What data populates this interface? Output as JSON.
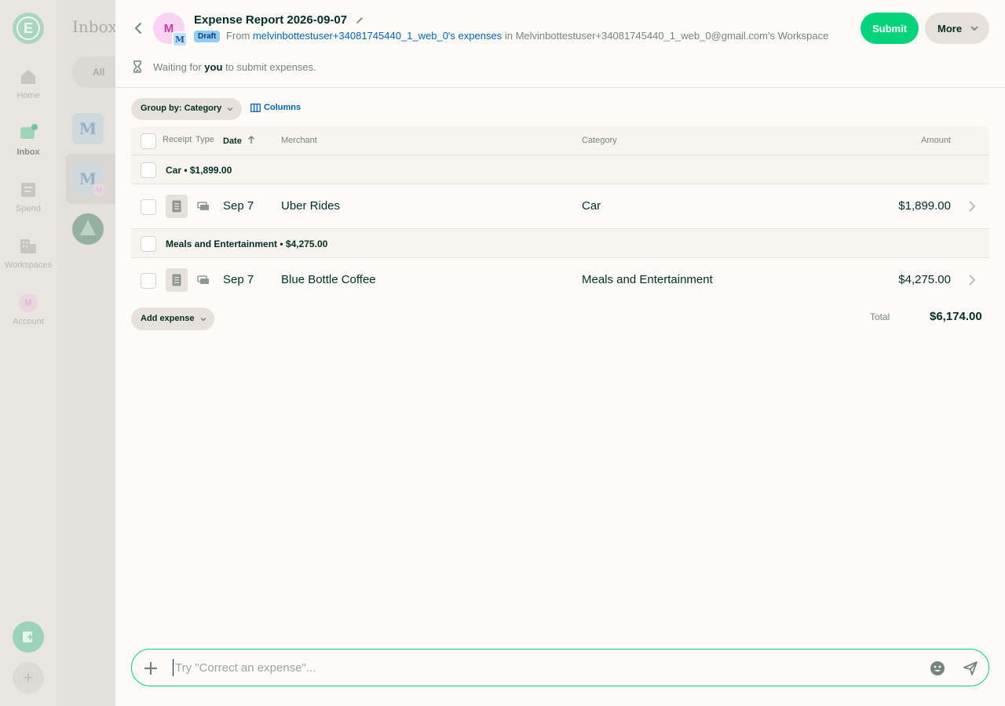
{
  "nav": {
    "items": [
      {
        "label": "Home",
        "icon": "home-icon"
      },
      {
        "label": "Inbox",
        "icon": "inbox-icon"
      },
      {
        "label": "Spend",
        "icon": "receipt-icon"
      },
      {
        "label": "Workspaces",
        "icon": "building-icon"
      },
      {
        "label": "Account",
        "icon": "avatar"
      }
    ],
    "account_initial": "M",
    "logo_letter": "E"
  },
  "inbox": {
    "title": "Inbox",
    "filter_label": "All",
    "avatar_letter": "M",
    "mini_avatar_letter": "M"
  },
  "report": {
    "title": "Expense Report 2026-09-07",
    "avatar_initial": "M",
    "workspace_initial": "M",
    "status_badge": "Draft",
    "from_label": "From",
    "from_link": "melvinbottestuser+34081745440_1_web_0's expenses",
    "in_label": "in",
    "workspace_name": "Melvinbottestuser+34081745440_1_web_0@gmail.com's Workspace",
    "submit_label": "Submit",
    "more_label": "More",
    "waiting_prefix": "Waiting for",
    "waiting_bold": "you",
    "waiting_suffix": "to submit expenses."
  },
  "toolbar": {
    "group_by_label": "Group by: Category",
    "columns_label": "Columns"
  },
  "table": {
    "columns": {
      "receipt": "Receipt",
      "type": "Type",
      "date": "Date",
      "merchant": "Merchant",
      "category": "Category",
      "amount": "Amount"
    },
    "groups": [
      {
        "heading": "Car • $1,899.00",
        "items": [
          {
            "date": "Sep 7",
            "merchant": "Uber Rides",
            "category": "Car",
            "amount": "$1,899.00"
          }
        ]
      },
      {
        "heading": "Meals and Entertainment • $4,275.00",
        "items": [
          {
            "date": "Sep 7",
            "merchant": "Blue Bottle Coffee",
            "category": "Meals and Entertainment",
            "amount": "$4,275.00"
          }
        ]
      }
    ]
  },
  "footer": {
    "add_expense_label": "Add expense",
    "total_label": "Total",
    "total_value": "$6,174.00"
  },
  "composer": {
    "placeholder": "Try \"Correct an expense\"..."
  },
  "colors": {
    "accent": "#03d47c",
    "link": "#0164bf",
    "text": "#002e22",
    "muted": "#76847e"
  }
}
